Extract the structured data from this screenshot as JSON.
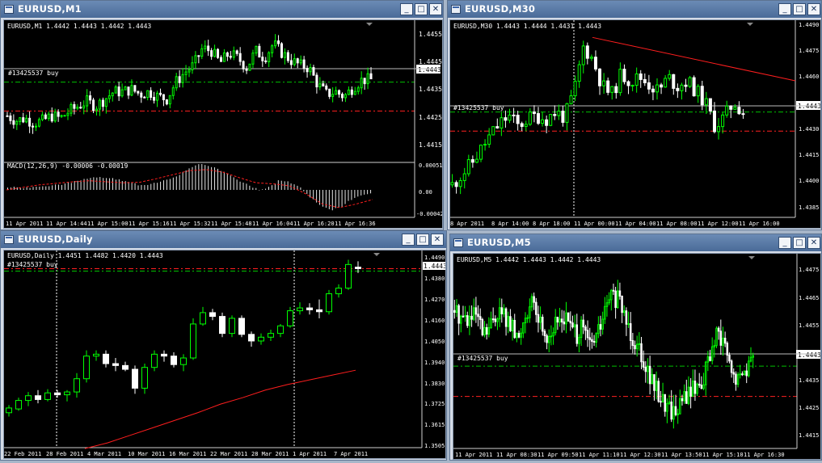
{
  "buttons": {
    "minimize": "_",
    "maximize": "□",
    "close": "✕"
  },
  "icons": {
    "window": "chart-window-icon"
  },
  "colors": {
    "bull": "#00ff00",
    "bear": "#ffffff",
    "grid": "#444444",
    "order_line": "#00c000",
    "stop_line": "#ff2020",
    "trend": "#ff1e1e",
    "bg": "#000000"
  },
  "windows": [
    {
      "title": "EURUSD,M1",
      "chart_info": "EURUSD,M1  1.4442 1.4443 1.4442 1.4443",
      "order_label": "#13425537 buy",
      "price_tag": "1.4443",
      "price_labels": [
        "1.4455",
        "1.4445",
        "1.4435",
        "1.4425",
        "1.4415"
      ],
      "time_labels": [
        "11 Apr 2011",
        "11 Apr 14:44",
        "11 Apr 15:00",
        "11 Apr 15:16",
        "11 Apr 15:32",
        "11 Apr 15:48",
        "11 Apr 16:04",
        "11 Apr 16:20",
        "11 Apr 16:36"
      ],
      "macd_info": "MACD(12,26,9) -0.00006 -0.00019",
      "macd_labels": [
        "0.00051",
        "0.00",
        "-0.00042"
      ],
      "price_range": [
        1.4408,
        1.4461
      ],
      "order_price": 1.444,
      "stop_price": 1.4428,
      "close_path": [
        1.4426,
        1.4424,
        1.4425,
        1.4423,
        1.4424,
        1.4426,
        1.4425,
        1.4428,
        1.443,
        1.4432,
        1.443,
        1.4433,
        1.4436,
        1.4436,
        1.4437,
        1.4435,
        1.4436,
        1.4434,
        1.4433,
        1.444,
        1.4444,
        1.4447,
        1.4454,
        1.4453,
        1.4448,
        1.4452,
        1.445,
        1.4446,
        1.4453,
        1.445,
        1.4456,
        1.4452,
        1.4449,
        1.4447,
        1.4446,
        1.4439,
        1.4435,
        1.4436,
        1.4434,
        1.4438,
        1.4441,
        1.4441
      ],
      "macd_values": [
        5e-05,
        5e-05,
        4e-05,
        6e-05,
        8e-05,
        0.0001,
        0.00013,
        0.00018,
        0.00022,
        0.00025,
        0.00024,
        0.0002,
        0.00015,
        0.0001,
        0.00011,
        0.00016,
        0.00022,
        0.0003,
        0.00042,
        0.0005,
        0.00048,
        0.0004,
        0.0003,
        0.00018,
        8e-05,
        0.0,
        6e-05,
        0.0002,
        0.00015,
        5e-05,
        -0.00015,
        -0.0003,
        -0.0004,
        -0.00035,
        -0.0002,
        -0.0001,
        -6e-05
      ],
      "macd_signal": [
        0.0,
        5e-05,
        0.0001,
        0.00013,
        0.00016,
        0.00018,
        0.00016,
        0.00014,
        0.00015,
        0.00022,
        0.0003,
        0.00038,
        0.0004,
        0.00035,
        0.00024,
        0.00014,
        0.00012,
        8e-05,
        -8e-05,
        -0.00028,
        -0.00035,
        -0.00028,
        -0.00019
      ]
    },
    {
      "title": "EURUSD,M30",
      "chart_info": "EURUSD,M30  1.4443 1.4444 1.4431 1.4443",
      "order_label": "#13425537 buy",
      "price_tag": "1.4443",
      "price_labels": [
        "1.4490",
        "1.4475",
        "1.4460",
        "1.4445",
        "1.4430",
        "1.4415",
        "1.4400",
        "1.4385"
      ],
      "time_labels": [
        "8 Apr 2011",
        "8 Apr 14:00",
        "8 Apr 18:00",
        "11 Apr 00:00",
        "11 Apr 04:00",
        "11 Apr 08:00",
        "11 Apr 12:00",
        "11 Apr 16:00"
      ],
      "price_range": [
        1.4383,
        1.4492
      ],
      "order_price": 1.444,
      "stop_price": 1.4429,
      "trend_start": 1.4483,
      "trend_end": 1.4458,
      "close_path": [
        1.4398,
        1.4404,
        1.441,
        1.4418,
        1.4426,
        1.4433,
        1.4438,
        1.4432,
        1.4436,
        1.4438,
        1.4436,
        1.444,
        1.4437,
        1.4452,
        1.4478,
        1.447,
        1.4455,
        1.445,
        1.4462,
        1.4458,
        1.446,
        1.4456,
        1.4452,
        1.446,
        1.4455,
        1.4458,
        1.4452,
        1.4445,
        1.4432,
        1.4437,
        1.4446,
        1.444
      ]
    },
    {
      "title": "EURUSD,Daily",
      "chart_info": "EURUSD,Daily  1.4451 1.4482 1.4420 1.4443",
      "order_label": "#13425537 buy",
      "price_tag": "1.4443",
      "price_labels": [
        "1.4490",
        "1.4380",
        "1.4270",
        "1.4160",
        "1.4050",
        "1.3940",
        "1.3830",
        "1.3725",
        "1.3615",
        "1.3505"
      ],
      "time_labels": [
        "22 Feb 2011",
        "28 Feb 2011",
        "4 Mar 2011",
        "10 Mar 2011",
        "16 Mar 2011",
        "22 Mar 2011",
        "28 Mar 2011",
        "1 Apr 2011",
        "7 Apr 2011"
      ],
      "price_range": [
        1.3495,
        1.4505
      ],
      "order_price": 1.443,
      "ma_path": [
        1.349,
        1.352,
        1.356,
        1.36,
        1.364,
        1.368,
        1.3725,
        1.376,
        1.38,
        1.383,
        1.3855,
        1.388,
        1.3905
      ],
      "candles": [
        {
          "o": 1.368,
          "h": 1.372,
          "l": 1.366,
          "c": 1.3705
        },
        {
          "o": 1.37,
          "h": 1.376,
          "l": 1.369,
          "c": 1.3745
        },
        {
          "o": 1.3745,
          "h": 1.379,
          "l": 1.3715,
          "c": 1.377
        },
        {
          "o": 1.377,
          "h": 1.38,
          "l": 1.373,
          "c": 1.375
        },
        {
          "o": 1.375,
          "h": 1.3805,
          "l": 1.374,
          "c": 1.3785
        },
        {
          "o": 1.3785,
          "h": 1.38,
          "l": 1.376,
          "c": 1.3775
        },
        {
          "o": 1.3775,
          "h": 1.38,
          "l": 1.374,
          "c": 1.379
        },
        {
          "o": 1.379,
          "h": 1.389,
          "l": 1.376,
          "c": 1.386
        },
        {
          "o": 1.386,
          "h": 1.401,
          "l": 1.384,
          "c": 1.398
        },
        {
          "o": 1.398,
          "h": 1.401,
          "l": 1.3955,
          "c": 1.399
        },
        {
          "o": 1.399,
          "h": 1.401,
          "l": 1.392,
          "c": 1.394
        },
        {
          "o": 1.394,
          "h": 1.397,
          "l": 1.39,
          "c": 1.393
        },
        {
          "o": 1.393,
          "h": 1.395,
          "l": 1.39,
          "c": 1.391
        },
        {
          "o": 1.391,
          "h": 1.393,
          "l": 1.378,
          "c": 1.381
        },
        {
          "o": 1.381,
          "h": 1.394,
          "l": 1.378,
          "c": 1.392
        },
        {
          "o": 1.392,
          "h": 1.401,
          "l": 1.39,
          "c": 1.399
        },
        {
          "o": 1.399,
          "h": 1.401,
          "l": 1.395,
          "c": 1.398
        },
        {
          "o": 1.398,
          "h": 1.4,
          "l": 1.392,
          "c": 1.3935
        },
        {
          "o": 1.3935,
          "h": 1.399,
          "l": 1.39,
          "c": 1.397
        },
        {
          "o": 1.397,
          "h": 1.418,
          "l": 1.396,
          "c": 1.415
        },
        {
          "o": 1.415,
          "h": 1.424,
          "l": 1.414,
          "c": 1.421
        },
        {
          "o": 1.421,
          "h": 1.423,
          "l": 1.417,
          "c": 1.419
        },
        {
          "o": 1.419,
          "h": 1.421,
          "l": 1.408,
          "c": 1.41
        },
        {
          "o": 1.41,
          "h": 1.4195,
          "l": 1.408,
          "c": 1.418
        },
        {
          "o": 1.418,
          "h": 1.4195,
          "l": 1.408,
          "c": 1.4095
        },
        {
          "o": 1.4095,
          "h": 1.411,
          "l": 1.403,
          "c": 1.406
        },
        {
          "o": 1.406,
          "h": 1.41,
          "l": 1.404,
          "c": 1.408
        },
        {
          "o": 1.408,
          "h": 1.412,
          "l": 1.406,
          "c": 1.41
        },
        {
          "o": 1.41,
          "h": 1.415,
          "l": 1.408,
          "c": 1.414
        },
        {
          "o": 1.414,
          "h": 1.424,
          "l": 1.413,
          "c": 1.422
        },
        {
          "o": 1.422,
          "h": 1.4265,
          "l": 1.42,
          "c": 1.4235
        },
        {
          "o": 1.4235,
          "h": 1.426,
          "l": 1.42,
          "c": 1.4225
        },
        {
          "o": 1.4225,
          "h": 1.428,
          "l": 1.418,
          "c": 1.4215
        },
        {
          "o": 1.4215,
          "h": 1.433,
          "l": 1.42,
          "c": 1.431
        },
        {
          "o": 1.431,
          "h": 1.436,
          "l": 1.429,
          "c": 1.434
        },
        {
          "o": 1.434,
          "h": 1.449,
          "l": 1.433,
          "c": 1.4465
        },
        {
          "o": 1.4451,
          "h": 1.4482,
          "l": 1.442,
          "c": 1.4443
        }
      ]
    },
    {
      "title": "EURUSD,M5",
      "chart_info": "EURUSD,M5  1.4442 1.4443 1.4442 1.4443",
      "order_label": "#13425537 buy",
      "price_tag": "1.4443",
      "price_labels": [
        "1.4475",
        "1.4465",
        "1.4455",
        "1.4445",
        "1.4435",
        "1.4425",
        "1.4415"
      ],
      "time_labels": [
        "11 Apr 2011",
        "11 Apr 08:30",
        "11 Apr 09:50",
        "11 Apr 11:10",
        "11 Apr 12:30",
        "11 Apr 13:50",
        "11 Apr 15:10",
        "11 Apr 16:30"
      ],
      "price_range": [
        1.4409,
        1.448
      ],
      "order_price": 1.444,
      "stop_price": 1.4428,
      "close_path": [
        1.4462,
        1.446,
        1.4458,
        1.446,
        1.4452,
        1.4455,
        1.4462,
        1.446,
        1.4455,
        1.445,
        1.4462,
        1.4464,
        1.4458,
        1.4452,
        1.4455,
        1.446,
        1.4458,
        1.4452,
        1.4455,
        1.4448,
        1.4452,
        1.446,
        1.4468,
        1.4466,
        1.446,
        1.4452,
        1.4448,
        1.444,
        1.4432,
        1.4428,
        1.4424,
        1.4422,
        1.4426,
        1.443,
        1.4432,
        1.4435,
        1.4445,
        1.4452,
        1.4448,
        1.4436,
        1.4434,
        1.444,
        1.4442
      ]
    }
  ]
}
